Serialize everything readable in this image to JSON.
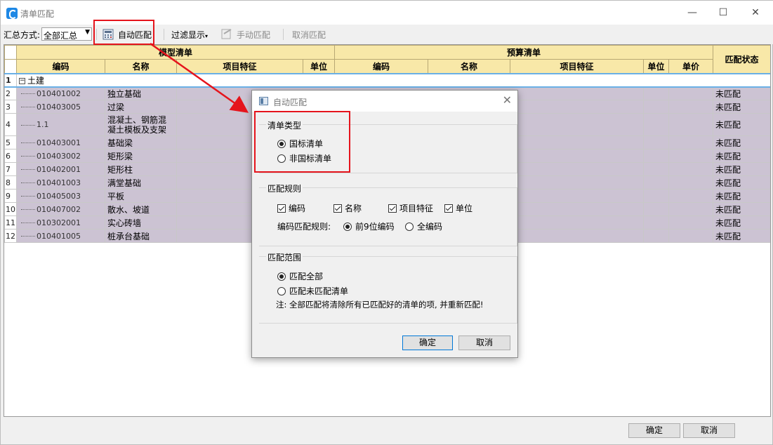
{
  "window": {
    "title": "清单匹配",
    "controls": {
      "min": "—",
      "max": "☐",
      "close": "✕"
    }
  },
  "toolbar": {
    "summary_label": "汇总方式:",
    "summary_value": "全部汇总",
    "auto_match": "自动匹配",
    "filter_display": "过滤显示",
    "manual_match": "手动匹配",
    "cancel_match": "取消匹配"
  },
  "grid": {
    "group_headers": {
      "model": "模型清单",
      "budget": "预算清单",
      "status": "匹配状态"
    },
    "columns": {
      "code": "编码",
      "name": "名称",
      "feature": "项目特征",
      "unit": "单位",
      "b_code": "编码",
      "b_name": "名称",
      "b_feature": "项目特征",
      "b_unit": "单位",
      "b_price": "单价"
    },
    "group_row": {
      "num": "1",
      "label": "土建",
      "toggle": "−"
    },
    "rows": [
      {
        "num": "2",
        "code": "010401002",
        "name": "独立基础",
        "status": "未匹配"
      },
      {
        "num": "3",
        "code": "010403005",
        "name": "过梁",
        "status": "未匹配"
      },
      {
        "num": "4",
        "code": "1.1",
        "name": "混凝土、钢筋混凝土模板及支架",
        "status": "未匹配"
      },
      {
        "num": "5",
        "code": "010403001",
        "name": "基础梁",
        "status": "未匹配"
      },
      {
        "num": "6",
        "code": "010403002",
        "name": "矩形梁",
        "status": "未匹配"
      },
      {
        "num": "7",
        "code": "010402001",
        "name": "矩形柱",
        "status": "未匹配"
      },
      {
        "num": "8",
        "code": "010401003",
        "name": "满堂基础",
        "status": "未匹配"
      },
      {
        "num": "9",
        "code": "010405003",
        "name": "平板",
        "status": "未匹配"
      },
      {
        "num": "10",
        "code": "010407002",
        "name": "散水、坡道",
        "status": "未匹配"
      },
      {
        "num": "11",
        "code": "010302001",
        "name": "实心砖墙",
        "status": "未匹配"
      },
      {
        "num": "12",
        "code": "010401005",
        "name": "桩承台基础",
        "status": "未匹配"
      }
    ]
  },
  "bottom": {
    "ok": "确定",
    "cancel": "取消"
  },
  "dialog": {
    "title": "自动匹配",
    "close": "✕",
    "list_type": {
      "label": "清单类型",
      "opt1": "国标清单",
      "opt2": "非国标清单",
      "selected": "国标清单"
    },
    "rules": {
      "label": "匹配规则",
      "c1": "编码",
      "c2": "名称",
      "c3": "项目特征",
      "c4": "单位",
      "code_rule_label": "编码匹配规则:",
      "r1": "前9位编码",
      "r2": "全编码",
      "selected": "前9位编码"
    },
    "scope": {
      "label": "匹配范围",
      "opt1": "匹配全部",
      "opt2": "匹配未匹配清单",
      "selected": "匹配全部",
      "note": "注: 全部匹配将清除所有已匹配好的清单的项, 并重新匹配!"
    },
    "ok": "确定",
    "cancel": "取消"
  },
  "colors": {
    "highlight": "#e5141c",
    "header_bg": "#f8e8a8",
    "row_bg": "#ccc3d3",
    "selection": "#6ab0e6"
  }
}
